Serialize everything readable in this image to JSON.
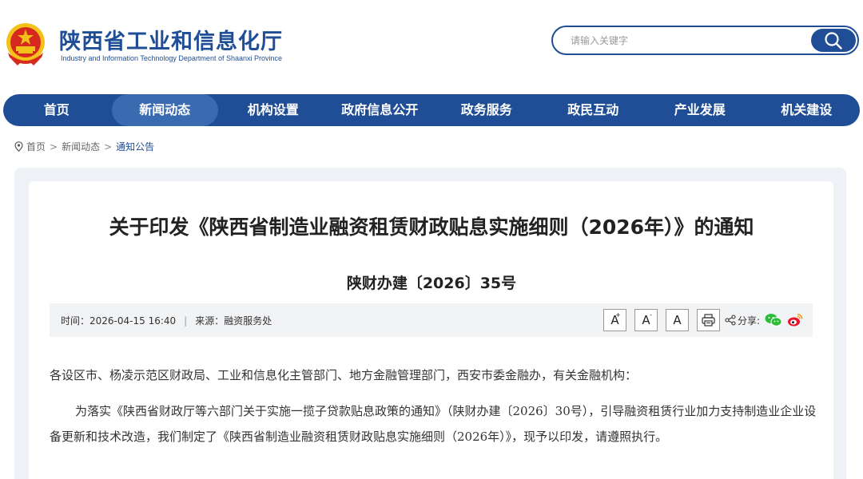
{
  "header": {
    "title": "陕西省工业和信息化厅",
    "subtitle": "Industry and Information Technology Department of Shaanxi Province",
    "search_placeholder": "请输入关键字",
    "colors": {
      "brand": "#1f4e96",
      "emblem_red": "#d62a1e",
      "emblem_gold": "#f3c21a"
    }
  },
  "nav": {
    "items": [
      "首页",
      "新闻动态",
      "机构设置",
      "政府信息公开",
      "政务服务",
      "政民互动",
      "产业发展",
      "机关建设"
    ],
    "active": "新闻动态"
  },
  "breadcrumb": {
    "home": "首页",
    "sep": ">",
    "level1": "新闻动态",
    "current": "通知公告"
  },
  "article": {
    "title": "关于印发《陕西省制造业融资租赁财政贴息实施细则（2026年）》的通知",
    "doc_number": "陕财办建〔2026〕35号",
    "meta": {
      "time_label": "时间：",
      "time": "2026-04-15 16:40",
      "divider": "|",
      "source_label": "来源：",
      "source": "融资服务处"
    },
    "font_buttons": [
      "A",
      "A",
      "A"
    ],
    "share_label": "分享:",
    "paragraph1": "各设区市、杨凌示范区财政局、工业和信息化主管部门、地方金融管理部门，西安市委金融办，有关金融机构：",
    "paragraph2": "为落实《陕西省财政厅等六部门关于实施一揽子贷款贴息政策的通知》（陕财办建〔2026〕30号），引导融资租赁行业加力支持制造业企业设备更新和技术改造，我们制定了《陕西省制造业融资租赁财政贴息实施细则（2026年）》，现予以印发，请遵照执行。"
  }
}
